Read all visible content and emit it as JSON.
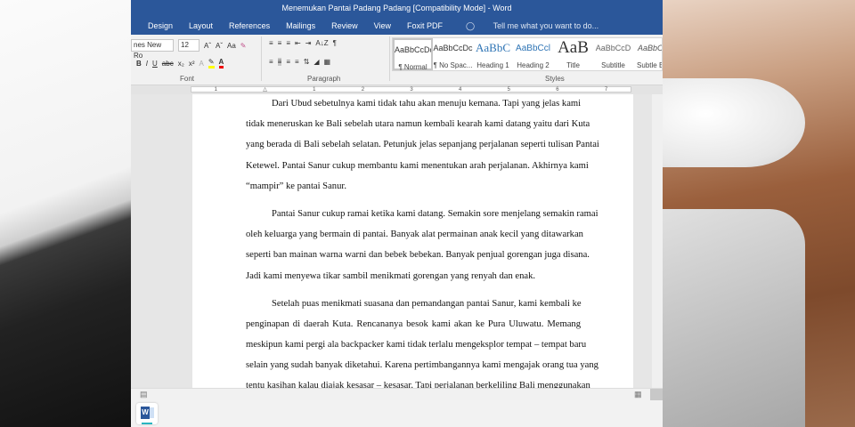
{
  "window": {
    "title": "Menemukan Pantai Padang Padang [Compatibility Mode] - Word"
  },
  "tabs": [
    "Design",
    "Layout",
    "References",
    "Mailings",
    "Review",
    "View",
    "Foxit PDF"
  ],
  "tell_me": "Tell me what you want to do...",
  "font": {
    "name": "nes New Ro",
    "size": "12",
    "group_label": "Font",
    "grow": "Aˆ",
    "shrink": "Aˇ",
    "case": "Aa",
    "bold": "B",
    "italic": "I",
    "underline": "U",
    "strike": "abc",
    "sub": "x₂",
    "sup": "x²",
    "color": "A"
  },
  "paragraph": {
    "group_label": "Paragraph",
    "sort": "A↓Z",
    "pilcrow": "¶"
  },
  "styles": {
    "group_label": "Styles",
    "items": [
      {
        "sample": "AaBbCcDc",
        "name": "¶ Normal"
      },
      {
        "sample": "AaBbCcDc",
        "name": "¶ No Spac..."
      },
      {
        "sample": "AaBbC",
        "name": "Heading 1"
      },
      {
        "sample": "AaBbCcl",
        "name": "Heading 2"
      },
      {
        "sample": "AaB",
        "name": "Title"
      },
      {
        "sample": "AaBbCcD",
        "name": "Subtitle"
      },
      {
        "sample": "AaBbCcl",
        "name": "Subtle Em"
      }
    ]
  },
  "ruler": [
    "1",
    "",
    "1",
    "2",
    "3",
    "4",
    "5",
    "6",
    "7"
  ],
  "document": {
    "paragraphs": [
      [
        "Dari Ubud sebetulnya kami tidak tahu akan menuju kemana. Tapi yang jelas kami",
        "tidak meneruskan ke Bali sebelah utara namun kembali kearah kami datang yaitu dari Kuta",
        "yang berada di Bali sebelah selatan. Petunjuk jelas sepanjang perjalanan seperti tulisan Pantai",
        "Ketewel. Pantai Sanur cukup membantu kami menentukan arah perjalanan. Akhirnya kami",
        "“mampir” ke pantai Sanur."
      ],
      [
        "Pantai Sanur cukup ramai ketika kami datang. Semakin sore menjelang semakin ramai",
        "oleh keluarga yang bermain di pantai. Banyak alat permainan anak kecil yang ditawarkan",
        "seperti ban mainan warna warni dan bebek bebekan. Banyak penjual gorengan juga disana.",
        "Jadi kami menyewa tikar sambil menikmati gorengan yang renyah dan enak."
      ],
      [
        "Setelah puas menikmati suasana dan pemandangan pantai Sanur,  kami kembali ke",
        "penginapan di daerah Kuta. Rencananya besok kami akan ke Pura Uluwatu. Memang",
        "meskipun kami pergi ala backpacker kami tidak terlalu mengeksplor tempat – tempat baru",
        "selain yang sudah banyak diketahui. Karena pertimbangannya kami mengajak orang tua yang",
        "tentu kasihan kalau diajak kesasar – kesasar. Tapi perjalanan berkeliling Bali menggunakan"
      ]
    ]
  },
  "taskbar": {
    "word_icon": "W"
  }
}
